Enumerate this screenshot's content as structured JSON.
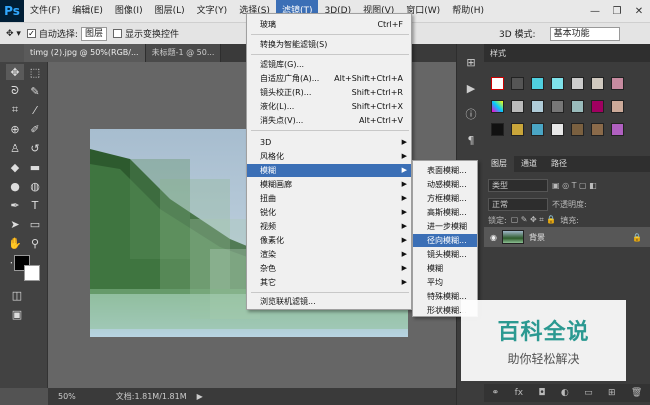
{
  "app": {
    "logo": "Ps"
  },
  "menubar": {
    "items": [
      "文件(F)",
      "编辑(E)",
      "图像(I)",
      "图层(L)",
      "文字(Y)",
      "选择(S)",
      "滤镜(T)",
      "3D(D)",
      "视图(V)",
      "窗口(W)",
      "帮助(H)"
    ],
    "active_index": 6
  },
  "window_controls": {
    "minimize": "—",
    "restore": "❐",
    "close": "✕"
  },
  "options": {
    "auto_select_label": "自动选择:",
    "auto_select_checked": "✓",
    "auto_select_value": "图层",
    "show_transform_label": "显示变换控件",
    "mode_3d": "3D 模式:",
    "workspace": "基本功能"
  },
  "tabs": [
    "timg (2).jpg @ 50%(RGB/...",
    "未标题-1 @ 50..."
  ],
  "canvas": {
    "photo_colors": [
      "#9fb6c8",
      "#2e5b2c",
      "#6fa777",
      "#b7d3e0"
    ]
  },
  "status": {
    "zoom": "50%",
    "doc": "文档:1.81M/1.81M"
  },
  "filter_menu": {
    "items": [
      {
        "label": "玻璃",
        "shortcut": "Ctrl+F"
      },
      {
        "label": "转换为智能滤镜(S)"
      },
      {
        "label": "滤镜库(G)..."
      },
      {
        "label": "自适应广角(A)...",
        "shortcut": "Alt+Shift+Ctrl+A"
      },
      {
        "label": "镜头校正(R)...",
        "shortcut": "Shift+Ctrl+R"
      },
      {
        "label": "液化(L)...",
        "shortcut": "Shift+Ctrl+X"
      },
      {
        "label": "消失点(V)...",
        "shortcut": "Alt+Ctrl+V"
      },
      {
        "label": "3D",
        "submenu": "▶"
      },
      {
        "label": "风格化",
        "submenu": "▶"
      },
      {
        "label": "模糊",
        "submenu": "▶"
      },
      {
        "label": "模糊画廊",
        "submenu": "▶"
      },
      {
        "label": "扭曲",
        "submenu": "▶"
      },
      {
        "label": "锐化",
        "submenu": "▶"
      },
      {
        "label": "视频",
        "submenu": "▶"
      },
      {
        "label": "像素化",
        "submenu": "▶"
      },
      {
        "label": "渲染",
        "submenu": "▶"
      },
      {
        "label": "杂色",
        "submenu": "▶"
      },
      {
        "label": "其它",
        "submenu": "▶"
      },
      {
        "label": "浏览联机滤镜..."
      }
    ],
    "highlighted": "模糊"
  },
  "blur_menu": {
    "items": [
      "表面模糊...",
      "动感模糊...",
      "方框模糊...",
      "高斯模糊...",
      "进一步模糊",
      "径向模糊...",
      "镜头模糊...",
      "模糊",
      "平均",
      "特殊模糊...",
      "形状模糊..."
    ],
    "highlighted": "径向模糊..."
  },
  "styles_panel": {
    "title": "样式"
  },
  "layers_panel": {
    "tabs": [
      "图层",
      "通道",
      "路径"
    ],
    "kind_label": "类型",
    "blend_mode": "正常",
    "opacity_label": "不透明度:",
    "lock_label": "锁定:",
    "fill_label": "填充:",
    "layer_name": "背景"
  },
  "watermark": {
    "title": "百科全说",
    "subtitle": "助你轻松解决"
  },
  "colors": {
    "accent": "#3b6fb6",
    "ui_dark": "#3c3c3c",
    "canvas_bg": "#666666",
    "watermark_title": "#2aa198"
  }
}
